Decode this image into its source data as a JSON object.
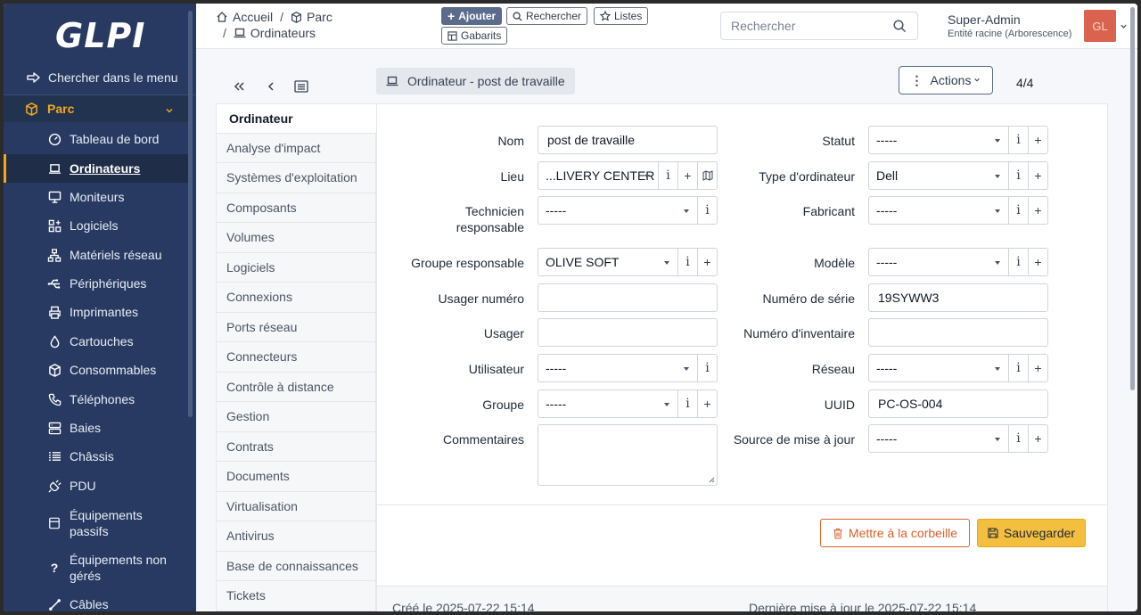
{
  "app": {
    "logo": "GLPI"
  },
  "sidebar": {
    "search_label": "Chercher dans le menu",
    "section_label": "Parc",
    "items": [
      {
        "label": "Tableau de bord",
        "icon": "dashboard-icon"
      },
      {
        "label": "Ordinateurs",
        "icon": "laptop-icon",
        "active": true
      },
      {
        "label": "Moniteurs",
        "icon": "monitor-icon"
      },
      {
        "label": "Logiciels",
        "icon": "apps-icon"
      },
      {
        "label": "Matériels réseau",
        "icon": "network-icon"
      },
      {
        "label": "Périphériques",
        "icon": "usb-icon"
      },
      {
        "label": "Imprimantes",
        "icon": "printer-icon"
      },
      {
        "label": "Cartouches",
        "icon": "droplet-icon"
      },
      {
        "label": "Consommables",
        "icon": "package-icon"
      },
      {
        "label": "Téléphones",
        "icon": "phone-icon"
      },
      {
        "label": "Baies",
        "icon": "server-icon"
      },
      {
        "label": "Châssis",
        "icon": "chassis-icon"
      },
      {
        "label": "PDU",
        "icon": "plug-icon"
      },
      {
        "label": "Équipements passifs",
        "icon": "box-icon"
      },
      {
        "label": "Équipements non gérés",
        "icon": "question-icon"
      },
      {
        "label": "Câbles",
        "icon": "cable-icon"
      }
    ]
  },
  "topbar": {
    "breadcrumb": {
      "home": "Accueil",
      "parc": "Parc",
      "current": "Ordinateurs"
    },
    "buttons": {
      "add": "Ajouter",
      "search": "Rechercher",
      "lists": "Listes",
      "templates": "Gabarits"
    },
    "search_placeholder": "Rechercher",
    "user": {
      "name": "Super-Admin",
      "entity": "Entité racine (Arborescence)",
      "initials": "GL"
    }
  },
  "item": {
    "title": "Ordinateur - post de travaille",
    "actions_label": "Actions",
    "counter": "4/4"
  },
  "tabs": [
    "Ordinateur",
    "Analyse d'impact",
    "Systèmes d'exploitation",
    "Composants",
    "Volumes",
    "Logiciels",
    "Connexions",
    "Ports réseau",
    "Connecteurs",
    "Contrôle à distance",
    "Gestion",
    "Contrats",
    "Documents",
    "Virtualisation",
    "Antivirus",
    "Base de connaissances",
    "Tickets"
  ],
  "form": {
    "labels": {
      "nom": "Nom",
      "lieu": "Lieu",
      "technicien": "Technicien responsable",
      "groupe_resp": "Groupe responsable",
      "usager_num": "Usager numéro",
      "usager": "Usager",
      "utilisateur": "Utilisateur",
      "groupe": "Groupe",
      "commentaires": "Commentaires",
      "statut": "Statut",
      "type": "Type d'ordinateur",
      "fabricant": "Fabricant",
      "modele": "Modèle",
      "serie": "Numéro de série",
      "inventaire": "Numéro d'inventaire",
      "reseau": "Réseau",
      "uuid": "UUID",
      "source": "Source de mise à jour"
    },
    "values": {
      "nom": "post de travaille",
      "lieu": "...LIVERY CENTER",
      "technicien": "-----",
      "groupe_resp": "OLIVE SOFT",
      "usager_num": "",
      "usager": "",
      "utilisateur": "-----",
      "groupe": "-----",
      "commentaires": "",
      "statut": "-----",
      "type": "Dell",
      "fabricant": "-----",
      "modele": "-----",
      "serie": "19SYWW3",
      "inventaire": "",
      "reseau": "-----",
      "uuid": "PC-OS-004",
      "source": "-----"
    },
    "addons": {
      "info": "i",
      "add": "+"
    },
    "trash_label": "Mettre à la corbeille",
    "save_label": "Sauvegarder",
    "created": "Créé le 2025-07-22 15:14",
    "updated": "Dernière mise à jour le 2025-07-22 15:14"
  },
  "colors": {
    "sidebar": "#283a61",
    "accent": "#f2a81d",
    "trash": "#d9622b",
    "save": "#f4bf3f",
    "avatar": "#d9634e"
  }
}
